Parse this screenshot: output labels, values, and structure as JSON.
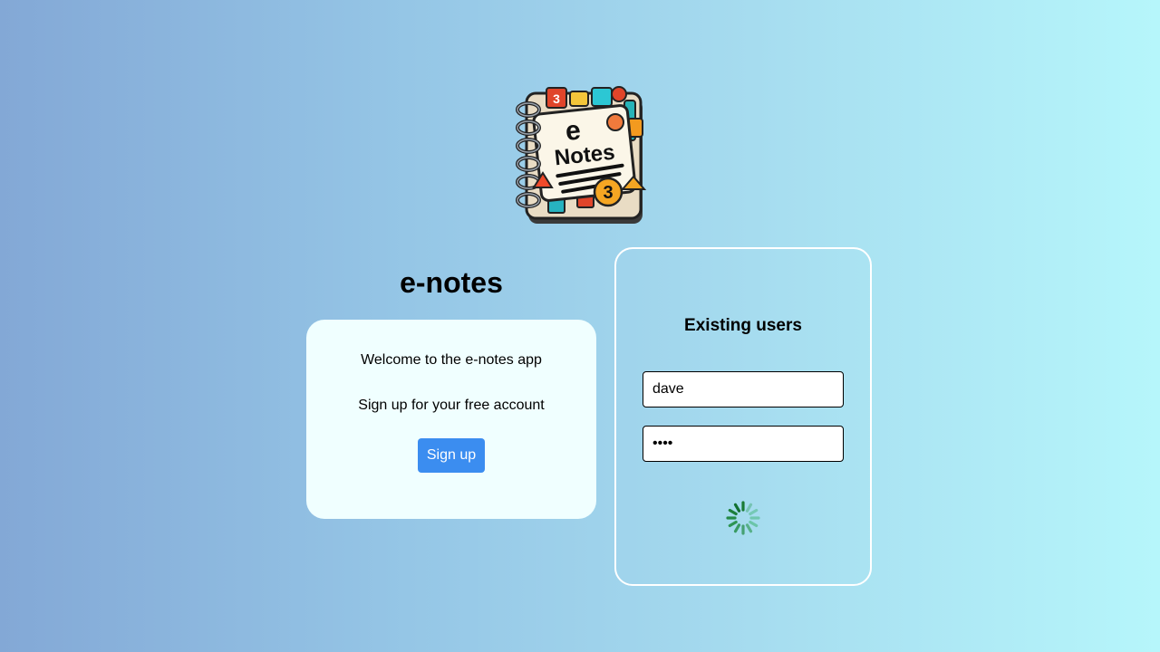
{
  "logo": {
    "text": "Notes",
    "letter": "e"
  },
  "app_title": "e-notes",
  "welcome": {
    "line1": "Welcome to the e-notes app",
    "line2": "Sign up for your free account",
    "signup_label": "Sign up"
  },
  "login": {
    "heading": "Existing users",
    "username_value": "dave",
    "password_value": "dave"
  },
  "spinner": {
    "icon": "loading-spinner-icon",
    "color": "#1a8a3a"
  },
  "colors": {
    "accent": "#3b8df0",
    "card_bg": "#f0ffff"
  }
}
